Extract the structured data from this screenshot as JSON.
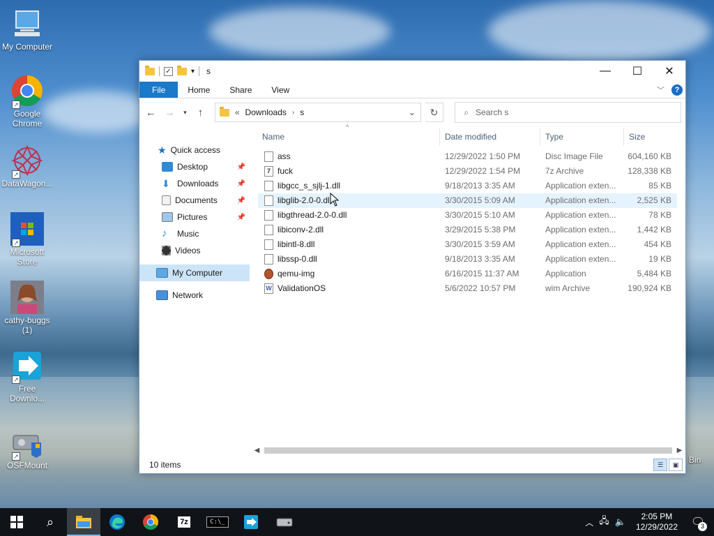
{
  "desktop": {
    "icons": [
      {
        "label": "My Computer"
      },
      {
        "label": "Google Chrome"
      },
      {
        "label": "DataWagon..."
      },
      {
        "label": "Microsoft Store"
      },
      {
        "label": "cathy-buggs (1)"
      },
      {
        "label": "Free Downlo..."
      },
      {
        "label": "OSFMount"
      }
    ],
    "recycle_partial": "Bin"
  },
  "window": {
    "title": "s",
    "ribbon_tabs": [
      "File",
      "Home",
      "Share",
      "View"
    ],
    "address": {
      "prefix": "«",
      "segments": [
        "Downloads",
        "s"
      ]
    },
    "search_placeholder": "Search s",
    "nav_pane": {
      "quick_access": "Quick access",
      "items": [
        {
          "label": "Desktop",
          "pinned": true
        },
        {
          "label": "Downloads",
          "pinned": true
        },
        {
          "label": "Documents",
          "pinned": true
        },
        {
          "label": "Pictures",
          "pinned": true
        },
        {
          "label": "Music",
          "pinned": false
        },
        {
          "label": "Videos",
          "pinned": false
        }
      ],
      "my_computer": "My Computer",
      "network": "Network"
    },
    "columns": {
      "name": "Name",
      "date": "Date modified",
      "type": "Type",
      "size": "Size"
    },
    "files": [
      {
        "name": "ass",
        "date": "12/29/2022 1:50 PM",
        "type": "Disc Image File",
        "size": "604,160 KB",
        "icon": "file-icon"
      },
      {
        "name": "fuck",
        "date": "12/29/2022 1:54 PM",
        "type": "7z Archive",
        "size": "128,338 KB",
        "icon": "7z-archive-icon"
      },
      {
        "name": "libgcc_s_sjlj-1.dll",
        "date": "9/18/2013 3:35 AM",
        "type": "Application exten...",
        "size": "85 KB",
        "icon": "dll-icon"
      },
      {
        "name": "libglib-2.0-0.dll",
        "date": "3/30/2015 5:09 AM",
        "type": "Application exten...",
        "size": "2,525 KB",
        "icon": "dll-icon"
      },
      {
        "name": "libgthread-2.0-0.dll",
        "date": "3/30/2015 5:10 AM",
        "type": "Application exten...",
        "size": "78 KB",
        "icon": "dll-icon"
      },
      {
        "name": "libiconv-2.dll",
        "date": "3/29/2015 5:38 PM",
        "type": "Application exten...",
        "size": "1,442 KB",
        "icon": "dll-icon"
      },
      {
        "name": "libintl-8.dll",
        "date": "3/30/2015 3:59 AM",
        "type": "Application exten...",
        "size": "454 KB",
        "icon": "dll-icon"
      },
      {
        "name": "libssp-0.dll",
        "date": "9/18/2013 3:35 AM",
        "type": "Application exten...",
        "size": "19 KB",
        "icon": "dll-icon"
      },
      {
        "name": "qemu-img",
        "date": "6/16/2015 11:37 AM",
        "type": "Application",
        "size": "5,484 KB",
        "icon": "qemu-app-icon"
      },
      {
        "name": "ValidationOS",
        "date": "5/6/2022 10:57 PM",
        "type": "wim Archive",
        "size": "190,924 KB",
        "icon": "wim-archive-icon"
      }
    ],
    "status": "10 items"
  },
  "taskbar": {
    "time": "2:05 PM",
    "date": "12/29/2022",
    "notification_count": "3"
  }
}
